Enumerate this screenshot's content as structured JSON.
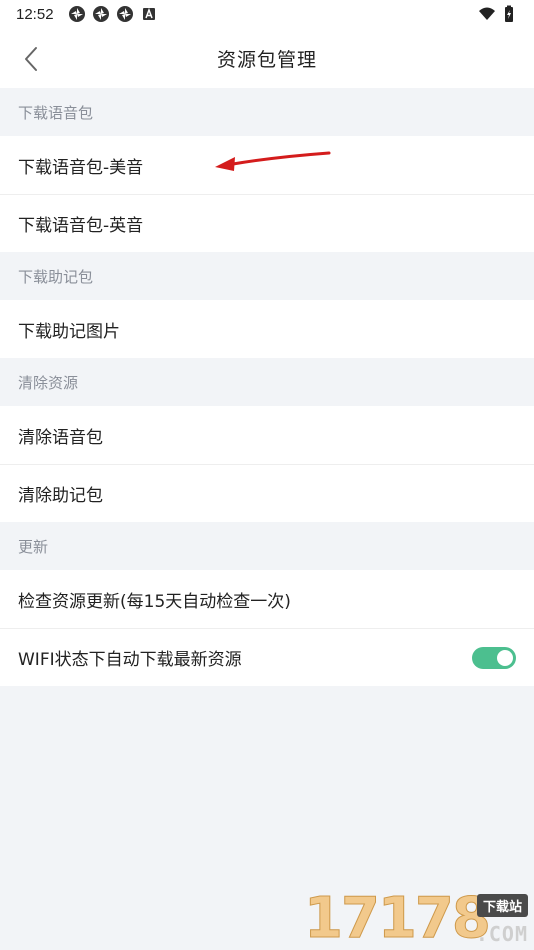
{
  "status_bar": {
    "time": "12:52",
    "left_icons": [
      "app-notification-icon",
      "app-notification-icon",
      "app-notification-icon",
      "font-a-icon"
    ],
    "right_icons": [
      "wifi-icon",
      "battery-charging-icon"
    ]
  },
  "header": {
    "title": "资源包管理",
    "back_icon": "chevron-left-icon"
  },
  "sections": [
    {
      "header": "下载语音包",
      "items": [
        "下载语音包-美音",
        "下载语音包-英音"
      ]
    },
    {
      "header": "下载助记包",
      "items": [
        "下载助记图片"
      ]
    },
    {
      "header": "清除资源",
      "items": [
        "清除语音包",
        "清除助记包"
      ]
    },
    {
      "header": "更新",
      "items": [
        "检查资源更新(每15天自动检查一次)",
        "WIFI状态下自动下载最新资源"
      ]
    }
  ],
  "auto_download_toggle": {
    "on": true
  },
  "colors": {
    "background": "#f2f4f7",
    "section_header_text": "#8a8f99",
    "toggle_on": "#4cbf8f",
    "annotation_arrow": "#e02020"
  },
  "watermark": {
    "digits": "17178",
    "badge": "下载站",
    "suffix": ".COM"
  }
}
